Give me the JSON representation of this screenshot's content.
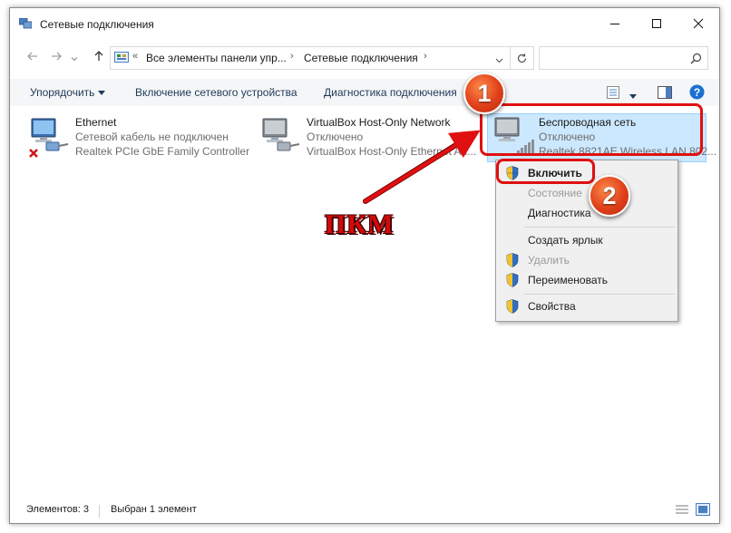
{
  "window": {
    "title": "Сетевые подключения"
  },
  "address": {
    "overflow": "«",
    "crumbs": [
      "Все элементы панели упр...",
      "Сетевые подключения"
    ],
    "search_placeholder": ""
  },
  "toolbar": {
    "organize": "Упорядочить",
    "enable_device": "Включение сетевого устройства",
    "diagnose": "Диагностика подключения"
  },
  "connections": [
    {
      "name": "Ethernet",
      "status": "Сетевой кабель не подключен",
      "adapter": "Realtek PCIe GbE Family Controller"
    },
    {
      "name": "VirtualBox Host-Only Network",
      "status": "Отключено",
      "adapter": "VirtualBox Host-Only Ethernet Ad..."
    },
    {
      "name": "Беспроводная сеть",
      "status": "Отключено",
      "adapter": "Realtek 8821AE Wireless LAN 802..."
    }
  ],
  "context_menu": {
    "items": [
      "Включить",
      "Состояние",
      "Диагностика",
      "Создать ярлык",
      "Удалить",
      "Переименовать",
      "Свойства"
    ]
  },
  "annotations": {
    "step1": "1",
    "step2": "2",
    "label": "ПКМ"
  },
  "statusbar": {
    "items_count": "Элементов: 3",
    "selected": "Выбран 1 элемент"
  },
  "colors": {
    "accent_red": "#e01010",
    "selection_bg": "#cce8ff",
    "toolbar_text": "#1e395b"
  }
}
